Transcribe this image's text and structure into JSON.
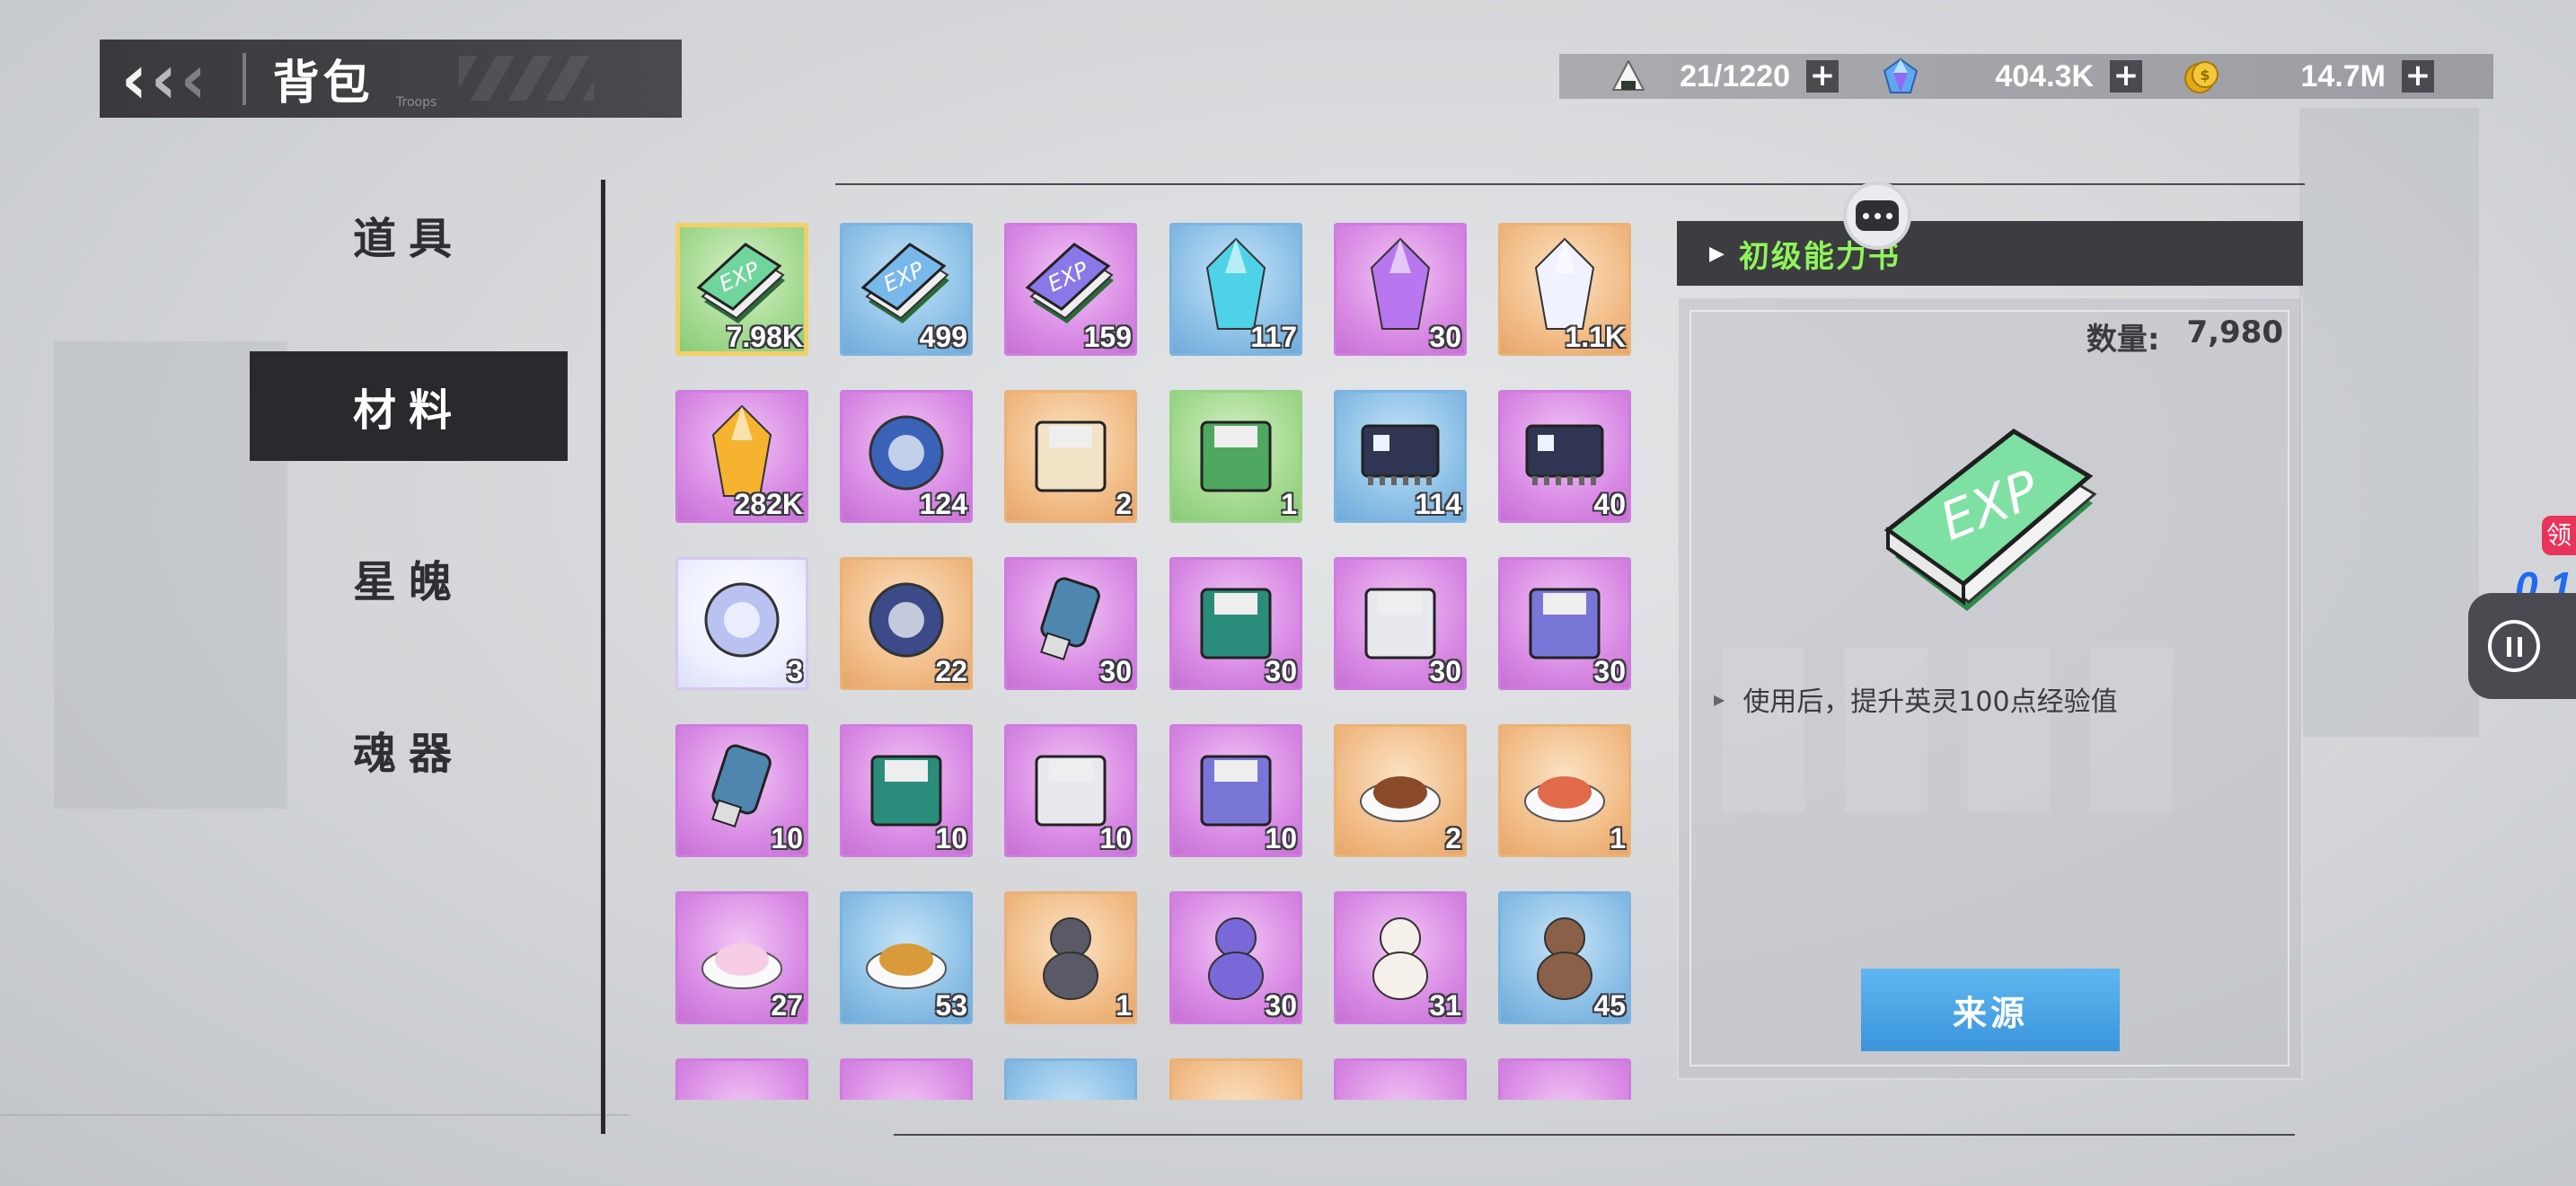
{
  "header": {
    "title": "背包",
    "subtitle": "Troops"
  },
  "currency": [
    {
      "icon": "onigiri-icon",
      "value": "21/1220"
    },
    {
      "icon": "crystal-icon",
      "value": "404.3K"
    },
    {
      "icon": "gold-coin-icon",
      "value": "14.7M"
    }
  ],
  "categories": [
    {
      "label": "道具",
      "active": false
    },
    {
      "label": "材料",
      "active": true
    },
    {
      "label": "星魄",
      "active": false
    },
    {
      "label": "魂器",
      "active": false
    }
  ],
  "items": [
    {
      "icon": "exp-book-green-icon",
      "rarity": "green",
      "count": "7.98K",
      "selected": true
    },
    {
      "icon": "exp-book-blue-icon",
      "rarity": "blue",
      "count": "499"
    },
    {
      "icon": "exp-book-purple-icon",
      "rarity": "purple",
      "count": "159"
    },
    {
      "icon": "blue-crystal-icon",
      "rarity": "blue",
      "count": "117"
    },
    {
      "icon": "purple-crystal-icon",
      "rarity": "purple",
      "count": "30"
    },
    {
      "icon": "white-crystal-icon",
      "rarity": "orange",
      "count": "1.1K"
    },
    {
      "icon": "golden-gem-icon",
      "rarity": "purple",
      "count": "282K"
    },
    {
      "icon": "dodecahedron-orb-icon",
      "rarity": "purple",
      "count": "124"
    },
    {
      "icon": "open-book-icon",
      "rarity": "orange",
      "count": "2"
    },
    {
      "icon": "trophy-card-icon",
      "rarity": "green",
      "count": "1"
    },
    {
      "icon": "chip-blue-icon",
      "rarity": "blue",
      "count": "114"
    },
    {
      "icon": "chip-purple-icon",
      "rarity": "purple",
      "count": "40"
    },
    {
      "icon": "energy-orb-white-icon",
      "rarity": "white",
      "count": "3"
    },
    {
      "icon": "energy-orb-orange-icon",
      "rarity": "orange",
      "count": "22"
    },
    {
      "icon": "usb-drive-icon",
      "rarity": "purple",
      "count": "30"
    },
    {
      "icon": "floppy-disk-icon",
      "rarity": "purple",
      "count": "30"
    },
    {
      "icon": "cd-disc-icon",
      "rarity": "purple",
      "count": "30"
    },
    {
      "icon": "game-cartridge-icon",
      "rarity": "purple",
      "count": "30"
    },
    {
      "icon": "usb-drive-icon",
      "rarity": "purple",
      "count": "10"
    },
    {
      "icon": "floppy-disk-icon",
      "rarity": "purple",
      "count": "10"
    },
    {
      "icon": "cd-disc-icon",
      "rarity": "purple",
      "count": "10"
    },
    {
      "icon": "game-cartridge-icon",
      "rarity": "purple",
      "count": "10"
    },
    {
      "icon": "steak-plate-icon",
      "rarity": "orange",
      "count": "2"
    },
    {
      "icon": "bento-box-icon",
      "rarity": "orange",
      "count": "1"
    },
    {
      "icon": "parfait-cup-icon",
      "rarity": "purple",
      "count": "27"
    },
    {
      "icon": "noodle-can-icon",
      "rarity": "blue",
      "count": "53"
    },
    {
      "icon": "figure-statue-icon",
      "rarity": "orange",
      "count": "1"
    },
    {
      "icon": "rabbit-doll-icon",
      "rarity": "purple",
      "count": "30"
    },
    {
      "icon": "lucky-cat-icon",
      "rarity": "purple",
      "count": "31"
    },
    {
      "icon": "teddy-bear-icon",
      "rarity": "blue",
      "count": "45"
    },
    {
      "icon": "item-partial-icon",
      "rarity": "purple",
      "count": ""
    },
    {
      "icon": "item-partial-icon",
      "rarity": "purple",
      "count": ""
    },
    {
      "icon": "item-partial-icon",
      "rarity": "blue",
      "count": ""
    },
    {
      "icon": "item-partial-icon",
      "rarity": "orange",
      "count": ""
    },
    {
      "icon": "item-partial-icon",
      "rarity": "purple",
      "count": ""
    },
    {
      "icon": "item-partial-icon",
      "rarity": "purple",
      "count": ""
    }
  ],
  "detail": {
    "name": "初级能力书",
    "quantity_label": "数量:",
    "quantity": "7,980",
    "description": "使用后，提升英灵100点经验值",
    "source_button": "来源",
    "icon": "exp-book-large-icon"
  },
  "side": {
    "tag": "领",
    "badge": "0.1"
  },
  "colors": {
    "accent_green": "#8ff55a",
    "button_blue": "#3b95dc",
    "panel_dark": "#3c3c41",
    "rarity_purple": "#d88ae4",
    "rarity_blue": "#8cc0e6",
    "rarity_orange": "#f1bc87",
    "rarity_green": "#a2d98f"
  }
}
